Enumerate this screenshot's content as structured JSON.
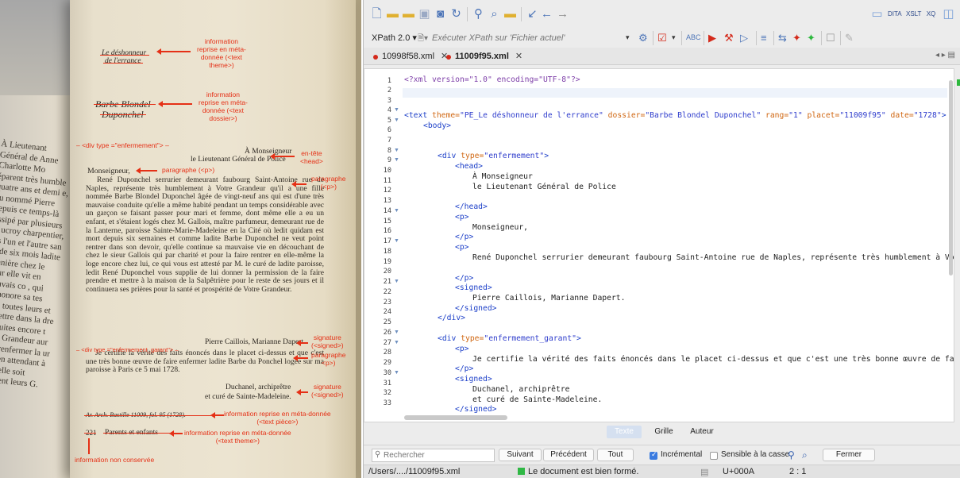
{
  "photo": {
    "page_title_1": "Le déshonneur",
    "page_title_2": "de l'errance",
    "page_author_1": "Barbe Blondel",
    "page_author_2": "Duponchel",
    "addressee_1": "À Monseigneur",
    "addressee_2": "le Lieutenant Général de Police",
    "salutation": "Monseigneur,",
    "body": "René Duponchel serrurier demeurant faubourg Saint-Antoine rue de Naples, représente très humblement à Votre Grandeur qu'il a une fille nommée Barbe Blondel Duponchel âgée de vingt-neuf ans qui est d'une très mauvaise conduite qu'elle a même habité pendant un temps considérable avec un garçon se faisant passer pour mari et femme, dont même elle a eu un enfant, et s'étaient logés chez M. Gallois, maître parfumeur, demeurant rue de la Lanterne, paroisse Sainte-Marie-Madeleine en la Cité où ledit quidam est mort depuis six semaines et comme ladite Barbe Duponchel ne veut point rentrer dans son devoir, qu'elle continue sa mauvaise vie en découchant de chez le sieur Gallois qui par charité et pour la faire rentrer en elle-même la loge encore chez lui, ce qui vous est attesté par M. le curé de ladite paroisse, ledit René Duponchel vous supplie de lui donner la permission de la faire prendre et mettre à la maison de la Salpêtrière pour le reste de ses jours et il continuera ses prières pour la santé et prospérité de Votre Grandeur.",
    "signature_1": "Pierre Caillois, Marianne Dapert.",
    "certify": "Je certifie la vérité des faits énoncés dans le placet ci-dessus et que c'est une très bonne œuvre de faire enfermer ladite Barbe du Ponchel logée sur ma paroisse à Paris ce 5 mai 1728.",
    "signature_2a": "Duchanel, archiprêtre",
    "signature_2b": "et curé de Sainte-Madeleine.",
    "archive_ref": "Ar. Arch. Bastille 11009, fol. 95 (1728).",
    "page_number": "221",
    "footer_theme": "Parents et enfants",
    "left_page_text": "À Lieutenant Général de Anne Charlotte Mo éparent très humble quatre ans et demi e, au nommé Pierre depuis ce temps-là lissipé par plusieurs fe ucroy charpentier, res l'un et l'autre san es de six mois ladite sonnière chez le sieur elle vit en mauvais co , qui déshonore sa tes avec toutes leurs et la mettre dans la dre des suites encore t Votre Grandeur aur faire renfermer la ur fille, en attendant à ce qu'elle soit cessèrent leurs G. Sev"
  },
  "annotations": {
    "a1": [
      "information",
      "reprise en méta-",
      "donnée (<text",
      "theme>)"
    ],
    "a2": [
      "information",
      "reprise en méta-",
      "donnée (<text",
      "dossier>)"
    ],
    "div1": "– <div type =\"enfermement\"> –",
    "entete": [
      "en-tête",
      "<head>"
    ],
    "para1": "paragraphe (<p>)",
    "para2": [
      "paragraphe",
      "(<p>)"
    ],
    "sig1": [
      "signature",
      "(<signed>)"
    ],
    "div2": "– <div type =\"enfermement_garant\"> –",
    "para3": [
      "paragraphe",
      "<p>)"
    ],
    "sig2": [
      "signature",
      "(<signed>)"
    ],
    "meta_piece": [
      "information reprise en méta-donnée",
      "(<text pièce>)"
    ],
    "meta_theme": [
      "information reprise en méta-donnée",
      "(<text theme>)"
    ],
    "not_kept": "information non conservée"
  },
  "toolbar": {
    "xpath_label": "XPath 2.0 ▾",
    "xpath_placeholder": "Exécuter XPath sur 'Fichier actuel'"
  },
  "tabs": [
    {
      "label": "10998f58.xml",
      "modified": true
    },
    {
      "label": "11009f95.xml",
      "modified": true,
      "active": true
    }
  ],
  "code_lines": [
    {
      "n": "1",
      "fold": false
    },
    {
      "n": "2",
      "fold": false
    },
    {
      "n": "3",
      "fold": false
    },
    {
      "n": "4",
      "fold": true
    },
    {
      "n": "5",
      "fold": true
    },
    {
      "n": "6",
      "fold": false
    },
    {
      "n": "7",
      "fold": false
    },
    {
      "n": "8",
      "fold": true
    },
    {
      "n": "9",
      "fold": true
    },
    {
      "n": "10",
      "fold": false
    },
    {
      "n": "11",
      "fold": false
    },
    {
      "n": "12",
      "fold": false
    },
    {
      "n": "13",
      "fold": false
    },
    {
      "n": "14",
      "fold": true
    },
    {
      "n": "15",
      "fold": false
    },
    {
      "n": "16",
      "fold": false
    },
    {
      "n": "17",
      "fold": true
    },
    {
      "n": "18",
      "fold": false
    },
    {
      "n": "19",
      "fold": false
    },
    {
      "n": "20",
      "fold": false
    },
    {
      "n": "21",
      "fold": true
    },
    {
      "n": "22",
      "fold": false
    },
    {
      "n": "23",
      "fold": false
    },
    {
      "n": "24",
      "fold": false
    },
    {
      "n": "25",
      "fold": false
    },
    {
      "n": "26",
      "fold": true
    },
    {
      "n": "27",
      "fold": true
    },
    {
      "n": "28",
      "fold": false
    },
    {
      "n": "29",
      "fold": false
    },
    {
      "n": "30",
      "fold": true
    },
    {
      "n": "31",
      "fold": false
    },
    {
      "n": "32",
      "fold": false
    },
    {
      "n": "33",
      "fold": false
    }
  ],
  "xml": {
    "decl": "<?xml version=\"1.0\" encoding=\"UTF-8\"?>",
    "text_open": "<text",
    "theme_attr": "theme=",
    "theme_val": "\"PE_Le déshonneur de l'errance\"",
    "dossier_attr": "dossier=",
    "dossier_val": "\"Barbe Blondel Duponchel\"",
    "rang_attr": "rang=",
    "rang_val": "\"1\"",
    "placet_attr": "placet=",
    "placet_val": "\"11009f95\"",
    "date_attr": "date=",
    "date_val": "\"1728\"",
    "gt": ">",
    "body": "<body>",
    "div_open": "<div",
    "type_attr": "type=",
    "type_val_1": "\"enfermement\"",
    "type_val_2": "\"enfermement_garant\"",
    "head_open": "<head>",
    "head_close": "</head>",
    "addr_1": "À Monseigneur",
    "addr_2": "le Lieutenant Général de Police",
    "p_open": "<p>",
    "p_close": "</p>",
    "salutation": "Monseigneur,",
    "line18": "René Duponchel serrurier demeurant faubourg Saint-Antoine rue de Naples, représente très humblement à Votre",
    "signed_open": "<signed>",
    "signed_close": "</signed>",
    "sig1": "Pierre Caillois, Marianne Dapert.",
    "div_close": "</div>",
    "line28": "Je certifie la vérité des faits énoncés dans le placet ci-dessus et que c'est une très bonne œuvre de faire",
    "sig2a": "Duchanel, archiprêtre",
    "sig2b": "et curé de Sainte-Madeleine."
  },
  "view_tabs": {
    "texte": "Texte",
    "grille": "Grille",
    "auteur": "Auteur"
  },
  "find": {
    "placeholder": "Rechercher",
    "next": "Suivant",
    "prev": "Précédent",
    "all": "Tout",
    "incremental": "Incrémental",
    "incremental_checked": true,
    "case": "Sensible à la casse",
    "case_checked": false,
    "close": "Fermer"
  },
  "status": {
    "path": "/Users/..../11009f95.xml",
    "wellformed": "Le document est bien formé.",
    "unicode": "U+000A",
    "position": "2 : 1"
  },
  "colors": {
    "annotation": "#e53016",
    "tag": "#1b3ec8",
    "attr_name": "#d06712",
    "attr_value": "#2e3ccc",
    "pi": "#7d3ea8",
    "ok_green": "#30b845"
  }
}
